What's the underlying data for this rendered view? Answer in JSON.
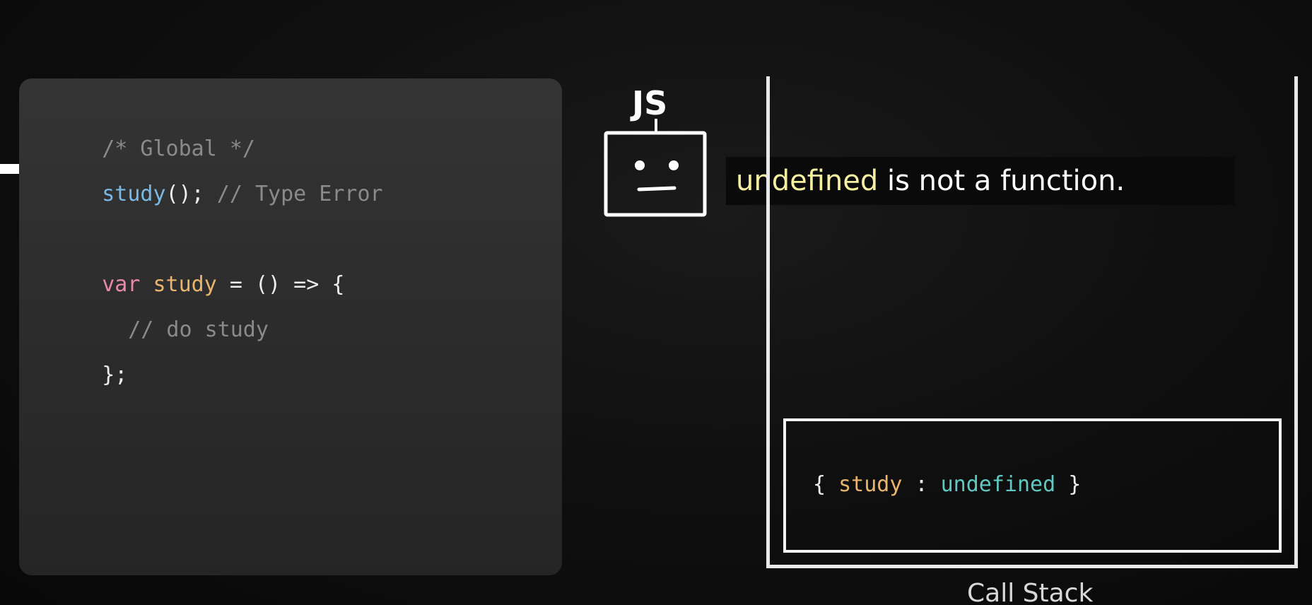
{
  "code": {
    "line1_comment": "/* Global */",
    "line2_call": "study",
    "line2_parens": "();",
    "line2_comment": " // Type Error",
    "line3_keyword": "var",
    "line3_ident": "study",
    "line3_rest": " = () => {",
    "line4_comment": "// do study",
    "line5_close": "};"
  },
  "robot": {
    "label": "JS"
  },
  "message": {
    "highlight": "undefined",
    "rest": " is not a function."
  },
  "call_stack": {
    "frame": {
      "open": "{ ",
      "key": "study",
      "sep": " : ",
      "value": "undefined",
      "close": " }"
    },
    "label": "Call Stack"
  },
  "colors": {
    "keyword": "#e88aa6",
    "identifier": "#e9b56e",
    "function_call": "#7ab8e6",
    "comment": "#8a8a8a",
    "value_undefined": "#5fc8c0",
    "message_highlight": "#f5f0a0"
  }
}
